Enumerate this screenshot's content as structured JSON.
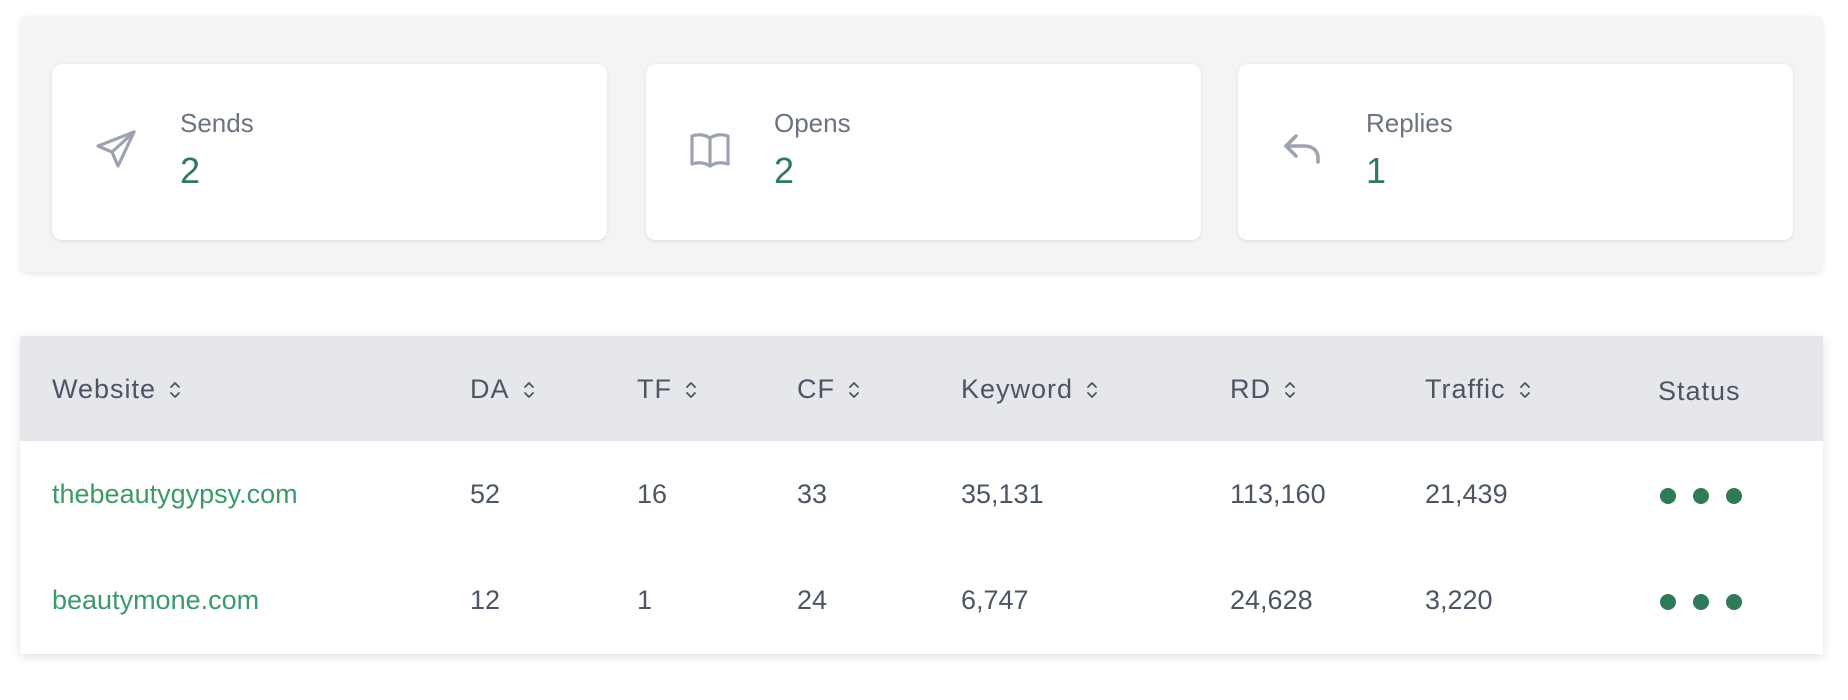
{
  "stats": [
    {
      "label": "Sends",
      "value": "2",
      "icon": "send-icon"
    },
    {
      "label": "Opens",
      "value": "2",
      "icon": "book-open-icon"
    },
    {
      "label": "Replies",
      "value": "1",
      "icon": "reply-icon"
    }
  ],
  "table": {
    "columns": [
      "Website",
      "DA",
      "TF",
      "CF",
      "Keyword",
      "RD",
      "Traffic",
      "Status"
    ],
    "rows": [
      {
        "website": "thebeautygypsy.com",
        "da": "52",
        "tf": "16",
        "cf": "33",
        "keyword": "35,131",
        "rd": "113,160",
        "traffic": "21,439",
        "status": "more"
      },
      {
        "website": "beautymone.com",
        "da": "12",
        "tf": "1",
        "cf": "24",
        "keyword": "6,747",
        "rd": "24,628",
        "traffic": "3,220",
        "status": "more"
      }
    ]
  },
  "colors": {
    "accent": "#2f7a57",
    "link": "#3a9a6a",
    "header_bg": "#e5e7eb",
    "panel_bg": "#f3f4f6"
  }
}
